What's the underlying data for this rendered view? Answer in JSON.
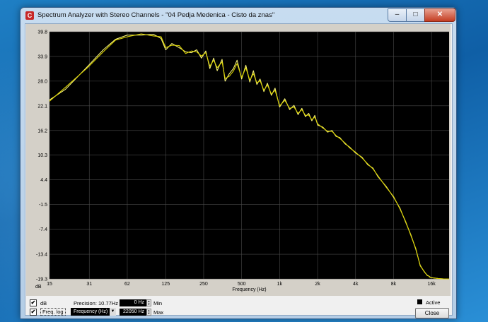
{
  "window": {
    "title": "Spectrum Analyzer with Stereo Channels - \"04 Pedja Medenica - Cisto da znas\"",
    "app_icon_glyph": "C",
    "min_glyph": "–",
    "max_glyph": "□",
    "close_glyph": "✕"
  },
  "chart_data": {
    "type": "line",
    "xlabel": "Frequency (Hz)",
    "ylabel": "dB",
    "x_scale": "log",
    "xlim": [
      15,
      22050
    ],
    "ylim": [
      -19.3,
      39.8
    ],
    "grid": true,
    "x_ticks": [
      {
        "value": 15,
        "label": "15"
      },
      {
        "value": 31,
        "label": "31"
      },
      {
        "value": 62,
        "label": "62"
      },
      {
        "value": 125,
        "label": "125"
      },
      {
        "value": 250,
        "label": "250"
      },
      {
        "value": 500,
        "label": "500"
      },
      {
        "value": 1000,
        "label": "1k"
      },
      {
        "value": 2000,
        "label": "2k"
      },
      {
        "value": 4000,
        "label": "4k"
      },
      {
        "value": 8000,
        "label": "8k"
      },
      {
        "value": 16000,
        "label": "16k"
      }
    ],
    "y_ticks": [
      {
        "value": 39.8,
        "label": "39.8"
      },
      {
        "value": 33.9,
        "label": "33.9"
      },
      {
        "value": 28.0,
        "label": "28.0"
      },
      {
        "value": 22.1,
        "label": "22.1"
      },
      {
        "value": 16.2,
        "label": "16.2"
      },
      {
        "value": 10.3,
        "label": "10.3"
      },
      {
        "value": 4.4,
        "label": "4.4"
      },
      {
        "value": -1.5,
        "label": "-1.5"
      },
      {
        "value": -7.4,
        "label": "-7.4"
      },
      {
        "value": -13.4,
        "label": "-13.4"
      },
      {
        "value": -19.3,
        "label": "-19.3"
      }
    ],
    "colors": {
      "background": "#000000",
      "grid": "#4a4a4a",
      "left": "#f5f07a",
      "right": "#dcd400"
    },
    "series": [
      {
        "color": "#f5f07a",
        "x": [
          15,
          20,
          30,
          40,
          50,
          62,
          80,
          100,
          115,
          125,
          140,
          160,
          180,
          200,
          220,
          240,
          260,
          280,
          300,
          320,
          350,
          370,
          400,
          430,
          460,
          500,
          540,
          580,
          620,
          660,
          700,
          750,
          800,
          860,
          920,
          1000,
          1100,
          1200,
          1300,
          1400,
          1500,
          1600,
          1700,
          1800,
          1900,
          2000,
          2200,
          2400,
          2600,
          2800,
          3000,
          3300,
          3600,
          4000,
          4500,
          5000,
          5500,
          6000,
          7000,
          8000,
          9000,
          10000,
          11000,
          12000,
          13000,
          14000,
          14800,
          15200,
          15500,
          16000,
          17000,
          18000,
          20000,
          22050
        ],
        "y": [
          23.5,
          26,
          31.5,
          35.5,
          38,
          39,
          39,
          39.2,
          38.2,
          35.5,
          37,
          36,
          35,
          34.8,
          35.5,
          33.5,
          35.2,
          31,
          33.5,
          30.5,
          33.2,
          28,
          29.8,
          31,
          33,
          28.5,
          31.8,
          27.8,
          30.5,
          27.2,
          28.5,
          25.5,
          27.5,
          24.6,
          26.3,
          21.8,
          23.8,
          21.2,
          22.2,
          20,
          21.5,
          19.5,
          20.3,
          18.5,
          19.8,
          17.5,
          17,
          15.8,
          16.2,
          14.8,
          14.5,
          13,
          12.2,
          10.8,
          9.8,
          8,
          7.2,
          5.2,
          2.8,
          0.2,
          -2.4,
          -5.8,
          -8.8,
          -12.2,
          -16,
          -17.6,
          -18.4,
          -18.6,
          -18.8,
          -19,
          -19.1,
          -19.2,
          -19.3,
          -19.3
        ]
      },
      {
        "color": "#dcd400",
        "x": [
          15,
          20,
          30,
          40,
          50,
          62,
          80,
          100,
          115,
          125,
          140,
          160,
          180,
          200,
          220,
          240,
          260,
          280,
          300,
          320,
          350,
          370,
          400,
          430,
          460,
          500,
          540,
          580,
          620,
          660,
          700,
          750,
          800,
          860,
          920,
          1000,
          1100,
          1200,
          1300,
          1400,
          1500,
          1600,
          1700,
          1800,
          1900,
          2000,
          2200,
          2400,
          2600,
          2800,
          3000,
          3300,
          3600,
          4000,
          4500,
          5000,
          5500,
          6000,
          7000,
          8000,
          9000,
          10000,
          11000,
          12000,
          13000,
          14000,
          14800,
          15200,
          15500,
          16000,
          17000,
          18000,
          20000,
          22050
        ],
        "y": [
          23.2,
          26.5,
          31.2,
          35,
          37.8,
          38.6,
          39.3,
          38.8,
          38.6,
          36,
          36.6,
          36.5,
          34.6,
          35.2,
          35,
          34,
          34.8,
          31.6,
          33,
          31.2,
          32.6,
          28.6,
          29.2,
          30.4,
          32.2,
          28.9,
          31.2,
          28.2,
          29.8,
          27.6,
          28.1,
          25.8,
          27.1,
          24.9,
          25.8,
          22.1,
          23.4,
          21.5,
          21.8,
          20.3,
          21.2,
          19.8,
          19.9,
          18.8,
          19.4,
          17.8,
          16.8,
          16,
          16,
          15,
          14.3,
          13.2,
          12,
          11,
          9.6,
          8.2,
          7,
          5.4,
          2.6,
          0.4,
          -2.6,
          -5.6,
          -9,
          -12,
          -16.2,
          -17.5,
          -18.5,
          -18.6,
          -18.9,
          -19,
          -19.1,
          -19.2,
          -19.3,
          -19.3
        ]
      }
    ]
  },
  "controls": {
    "db_label": "dB",
    "freq_log_label": "Freq. log",
    "db_checked": "✔",
    "freq_log_checked": "✔",
    "precision_label": "Precision: 10.77Hz",
    "min_value": "0 Hz",
    "min_label": "Min",
    "max_value": "22050 Hz",
    "max_label": "Max",
    "axis_select_value": "Frequency (Hz)",
    "active_label": "Active",
    "close_label": "Close",
    "spin_up_glyph": "▲",
    "spin_down_glyph": "▼",
    "dropdown_glyph": "▼"
  }
}
